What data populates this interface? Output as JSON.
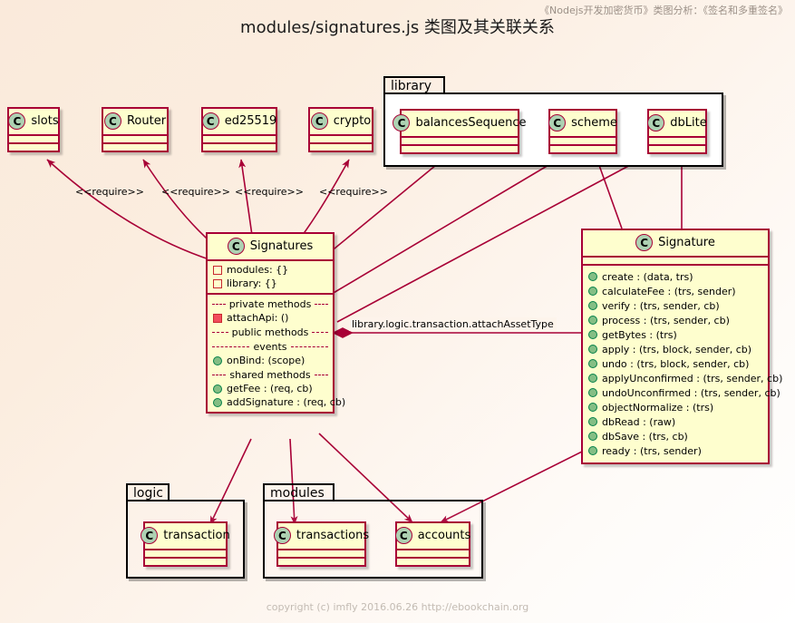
{
  "header": {
    "corner_note": "《Nodejs开发加密货币》类图分析：《签名和多重签名》",
    "title": "modules/signatures.js 类图及其关联关系",
    "footer": "copyright (c) imfly 2016.06.26 http://ebookchain.org"
  },
  "colors": {
    "class_border": "#A80036",
    "class_fill": "#FEFECE",
    "icon_fill": "#ADD1B2",
    "arrow": "#A80036",
    "package_border": "#000000",
    "public_member": "#84BE84",
    "private_member": "#F24D5C"
  },
  "packages": [
    {
      "name": "library",
      "label": "library"
    },
    {
      "name": "logic",
      "label": "logic"
    },
    {
      "name": "modules",
      "label": "modules"
    }
  ],
  "classes": {
    "slots": {
      "name": "slots",
      "icon": "C"
    },
    "router": {
      "name": "Router",
      "icon": "C"
    },
    "ed25519": {
      "name": "ed25519",
      "icon": "C"
    },
    "crypto": {
      "name": "crypto",
      "icon": "C"
    },
    "balancesSequence": {
      "name": "balancesSequence",
      "icon": "C"
    },
    "scheme": {
      "name": "scheme",
      "icon": "C"
    },
    "dbLite": {
      "name": "dbLite",
      "icon": "C"
    },
    "transaction": {
      "name": "transaction",
      "icon": "C"
    },
    "transactions": {
      "name": "transactions",
      "icon": "C"
    },
    "accounts": {
      "name": "accounts",
      "icon": "C"
    }
  },
  "signatures_class": {
    "name": "Signatures",
    "icon": "C",
    "fields": [
      {
        "vis": "package",
        "text": "modules: {}"
      },
      {
        "vis": "package",
        "text": "library: {}"
      }
    ],
    "groups": [
      {
        "divider": "private methods",
        "members": [
          {
            "vis": "private",
            "text": "attachApi: ()"
          }
        ]
      },
      {
        "divider": "public methods",
        "members": []
      },
      {
        "divider": "events",
        "members": [
          {
            "vis": "public",
            "text": "onBind: (scope)"
          }
        ]
      },
      {
        "divider": "shared methods",
        "members": [
          {
            "vis": "public",
            "text": "getFee :  (req, cb)"
          },
          {
            "vis": "public",
            "text": "addSignature :  (req, cb)"
          }
        ]
      }
    ]
  },
  "signature_class": {
    "name": "Signature",
    "icon": "C",
    "methods": [
      {
        "vis": "public",
        "text": "create :  (data, trs)"
      },
      {
        "vis": "public",
        "text": "calculateFee :  (trs, sender)"
      },
      {
        "vis": "public",
        "text": "verify :  (trs, sender, cb)"
      },
      {
        "vis": "public",
        "text": "process :  (trs, sender, cb)"
      },
      {
        "vis": "public",
        "text": "getBytes :  (trs)"
      },
      {
        "vis": "public",
        "text": "apply :  (trs, block, sender, cb)"
      },
      {
        "vis": "public",
        "text": "undo :  (trs, block, sender, cb)"
      },
      {
        "vis": "public",
        "text": "applyUnconfirmed :  (trs, sender, cb)"
      },
      {
        "vis": "public",
        "text": "undoUnconfirmed :  (trs, sender, cb)"
      },
      {
        "vis": "public",
        "text": "objectNormalize :  (trs)"
      },
      {
        "vis": "public",
        "text": "dbRead :  (raw)"
      },
      {
        "vis": "public",
        "text": "dbSave :  (trs, cb)"
      },
      {
        "vis": "public",
        "text": "ready :  (trs, sender)"
      }
    ]
  },
  "edge_labels": {
    "require_1": "<<require>>",
    "require_2": "<<require>>",
    "require_3": "<<require>>",
    "require_4": "<<require>>",
    "composition": "library.logic.transaction.attachAssetType"
  }
}
